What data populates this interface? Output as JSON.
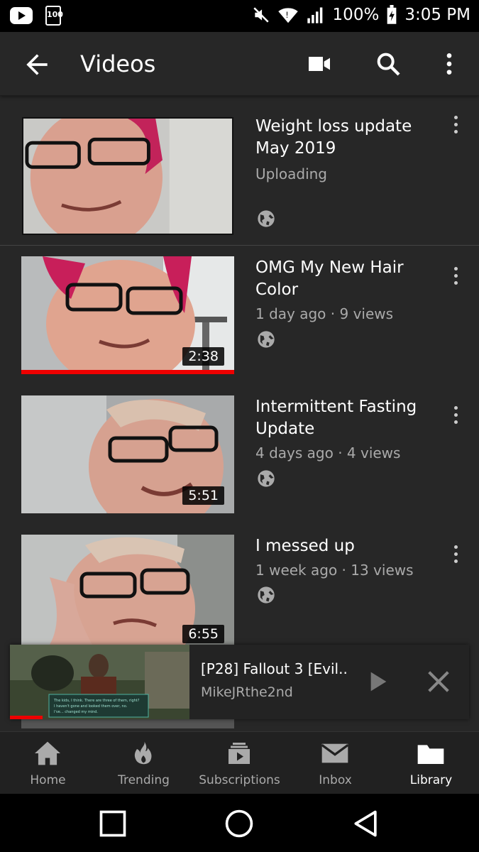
{
  "status_bar": {
    "battery": "100%",
    "time": "3:05 PM",
    "hundred_badge": "100"
  },
  "app_bar": {
    "title": "Videos",
    "icons": [
      "back-arrow-icon",
      "video-camera-icon",
      "search-icon",
      "more-vert-icon"
    ]
  },
  "videos": [
    {
      "title": "Weight loss update May 2019",
      "meta": "Uploading",
      "duration": "",
      "watched_fraction": 0
    },
    {
      "title": "OMG My New Hair Color",
      "meta": "1 day ago · 9 views",
      "duration": "2:38",
      "watched_fraction": 1.0
    },
    {
      "title": "Intermittent Fasting Update",
      "meta": "4 days ago · 4 views",
      "duration": "5:51",
      "watched_fraction": 0
    },
    {
      "title": "I messed up",
      "meta": "1 week ago · 13 views",
      "duration": "6:55",
      "watched_fraction": 0
    }
  ],
  "mini_player": {
    "title": "[P28] Fallout 3 [Evil..",
    "channel": "MikeJRthe2nd",
    "progress_fraction": 0.18
  },
  "bottom_nav": [
    {
      "label": "Home",
      "icon": "home-icon"
    },
    {
      "label": "Trending",
      "icon": "flame-icon"
    },
    {
      "label": "Subscriptions",
      "icon": "subscriptions-icon"
    },
    {
      "label": "Inbox",
      "icon": "mail-icon"
    },
    {
      "label": "Library",
      "icon": "folder-icon",
      "active": true
    }
  ],
  "colors": {
    "background": "#272727",
    "accent_red": "#ff0000",
    "text_secondary": "#aaaaaa"
  }
}
